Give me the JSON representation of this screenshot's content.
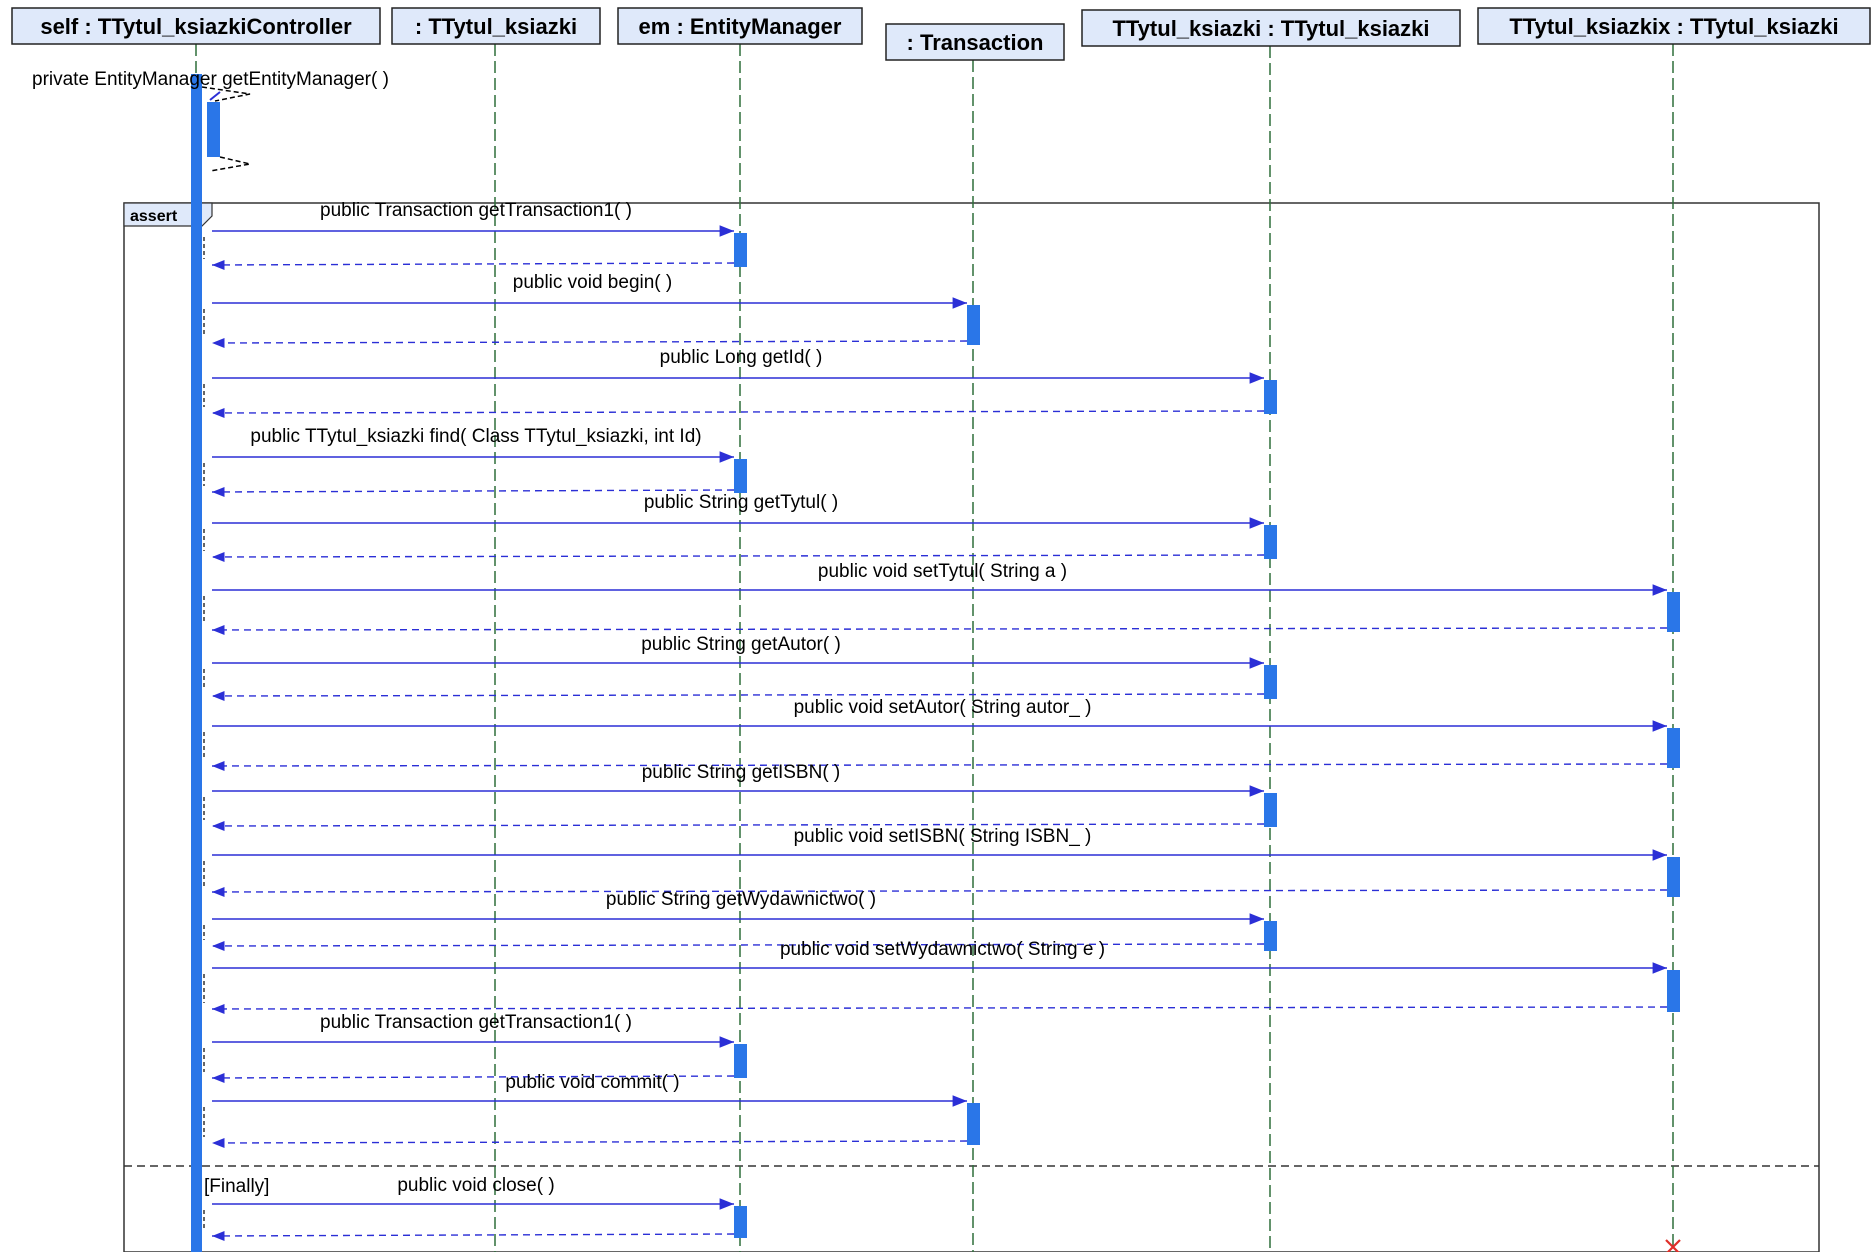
{
  "lifelines": [
    {
      "id": "self",
      "label": "self : TTytul_ksiazkiController"
    },
    {
      "id": "tk",
      "label": ": TTytul_ksiazki"
    },
    {
      "id": "em",
      "label": "em : EntityManager"
    },
    {
      "id": "tx",
      "label": ": Transaction"
    },
    {
      "id": "tt",
      "label": "TTytul_ksiazki : TTytul_ksiazki"
    },
    {
      "id": "tx2",
      "label": "TTytul_ksiazkix : TTytul_ksiazki"
    }
  ],
  "self_call": {
    "label": "private EntityManager  getEntityManager( )"
  },
  "fragment": {
    "operator": "assert",
    "guard": "[Finally]"
  },
  "messages": [
    {
      "label": "public Transaction  getTransaction1( )",
      "to": "em",
      "section": 1
    },
    {
      "label": "public void  begin( )",
      "to": "tx",
      "section": 1
    },
    {
      "label": "public Long  getId( )",
      "to": "tt",
      "section": 1
    },
    {
      "label": "public TTytul_ksiazki  find( Class TTytul_ksiazki, int Id)",
      "to": "em",
      "section": 1
    },
    {
      "label": "public String  getTytul( )",
      "to": "tt",
      "section": 1
    },
    {
      "label": "public void  setTytul( String a )",
      "to": "tx2",
      "section": 1
    },
    {
      "label": "public String  getAutor( )",
      "to": "tt",
      "section": 1
    },
    {
      "label": "public void  setAutor( String autor_ )",
      "to": "tx2",
      "section": 1
    },
    {
      "label": "public String  getISBN( )",
      "to": "tt",
      "section": 1
    },
    {
      "label": "public void  setISBN( String ISBN_ )",
      "to": "tx2",
      "section": 1
    },
    {
      "label": "public String  getWydawnictwo( )",
      "to": "tt",
      "section": 1
    },
    {
      "label": "public void  setWydawnictwo( String e )",
      "to": "tx2",
      "section": 1
    },
    {
      "label": "public Transaction  getTransaction1( )",
      "to": "em",
      "section": 1
    },
    {
      "label": "public void  commit( )",
      "to": "tx",
      "section": 1
    },
    {
      "label": "public void  close( )",
      "to": "em",
      "section": 2
    }
  ],
  "colors": {
    "header_fill": "#dfe9fa",
    "activation": "#2a76e8",
    "message_line": "#2b2fd6",
    "lifeline": "#2e6e3a",
    "destroy": "#e0302a"
  }
}
